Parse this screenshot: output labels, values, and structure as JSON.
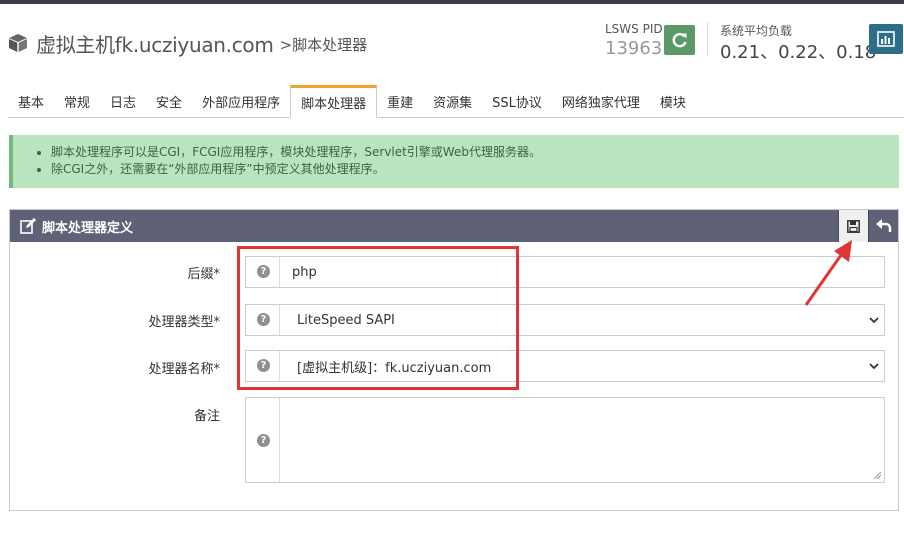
{
  "header": {
    "title": "虚拟主机fk.ucziyuan.com",
    "breadcrumb": ">脚本处理器",
    "pid_label": "LSWS PID",
    "pid_value": "13963",
    "load_label": "系统平均负载",
    "load_value": "0.21、0.22、0.18"
  },
  "tabs": [
    {
      "label": "基本"
    },
    {
      "label": "常规"
    },
    {
      "label": "日志"
    },
    {
      "label": "安全"
    },
    {
      "label": "外部应用程序"
    },
    {
      "label": "脚本处理器",
      "active": true
    },
    {
      "label": "重建"
    },
    {
      "label": "资源集"
    },
    {
      "label": "SSL协议"
    },
    {
      "label": "网络独家代理"
    },
    {
      "label": "模块"
    }
  ],
  "alert": {
    "items": [
      "脚本处理程序可以是CGI，FCGI应用程序，模块处理程序，Servlet引擎或Web代理服务器。",
      "除CGI之外，还需要在“外部应用程序”中预定义其他处理程序。"
    ]
  },
  "panel": {
    "title": "脚本处理器定义",
    "fields": {
      "suffix": {
        "label": "后缀*",
        "value": "php"
      },
      "handler_type": {
        "label": "处理器类型*",
        "value": "LiteSpeed SAPI"
      },
      "handler_name": {
        "label": "处理器名称*",
        "value": "[虚拟主机级]：fk.ucziyuan.com"
      },
      "notes": {
        "label": "备注",
        "value": ""
      }
    },
    "help_glyph": "?"
  },
  "icons": {
    "logo": "cube-icon",
    "restart": "refresh-icon",
    "stats": "bar-chart-icon",
    "edit": "edit-icon",
    "save": "save-icon",
    "undo": "undo-icon",
    "help": "question-circle-icon"
  },
  "colors": {
    "accent_tab": "#f0a430",
    "panel_header": "#5f6176",
    "alert_bg": "#b8e5bf",
    "restart_btn": "#5b9a68",
    "stats_btn": "#2c6e8a",
    "annotation": "#e03535"
  }
}
